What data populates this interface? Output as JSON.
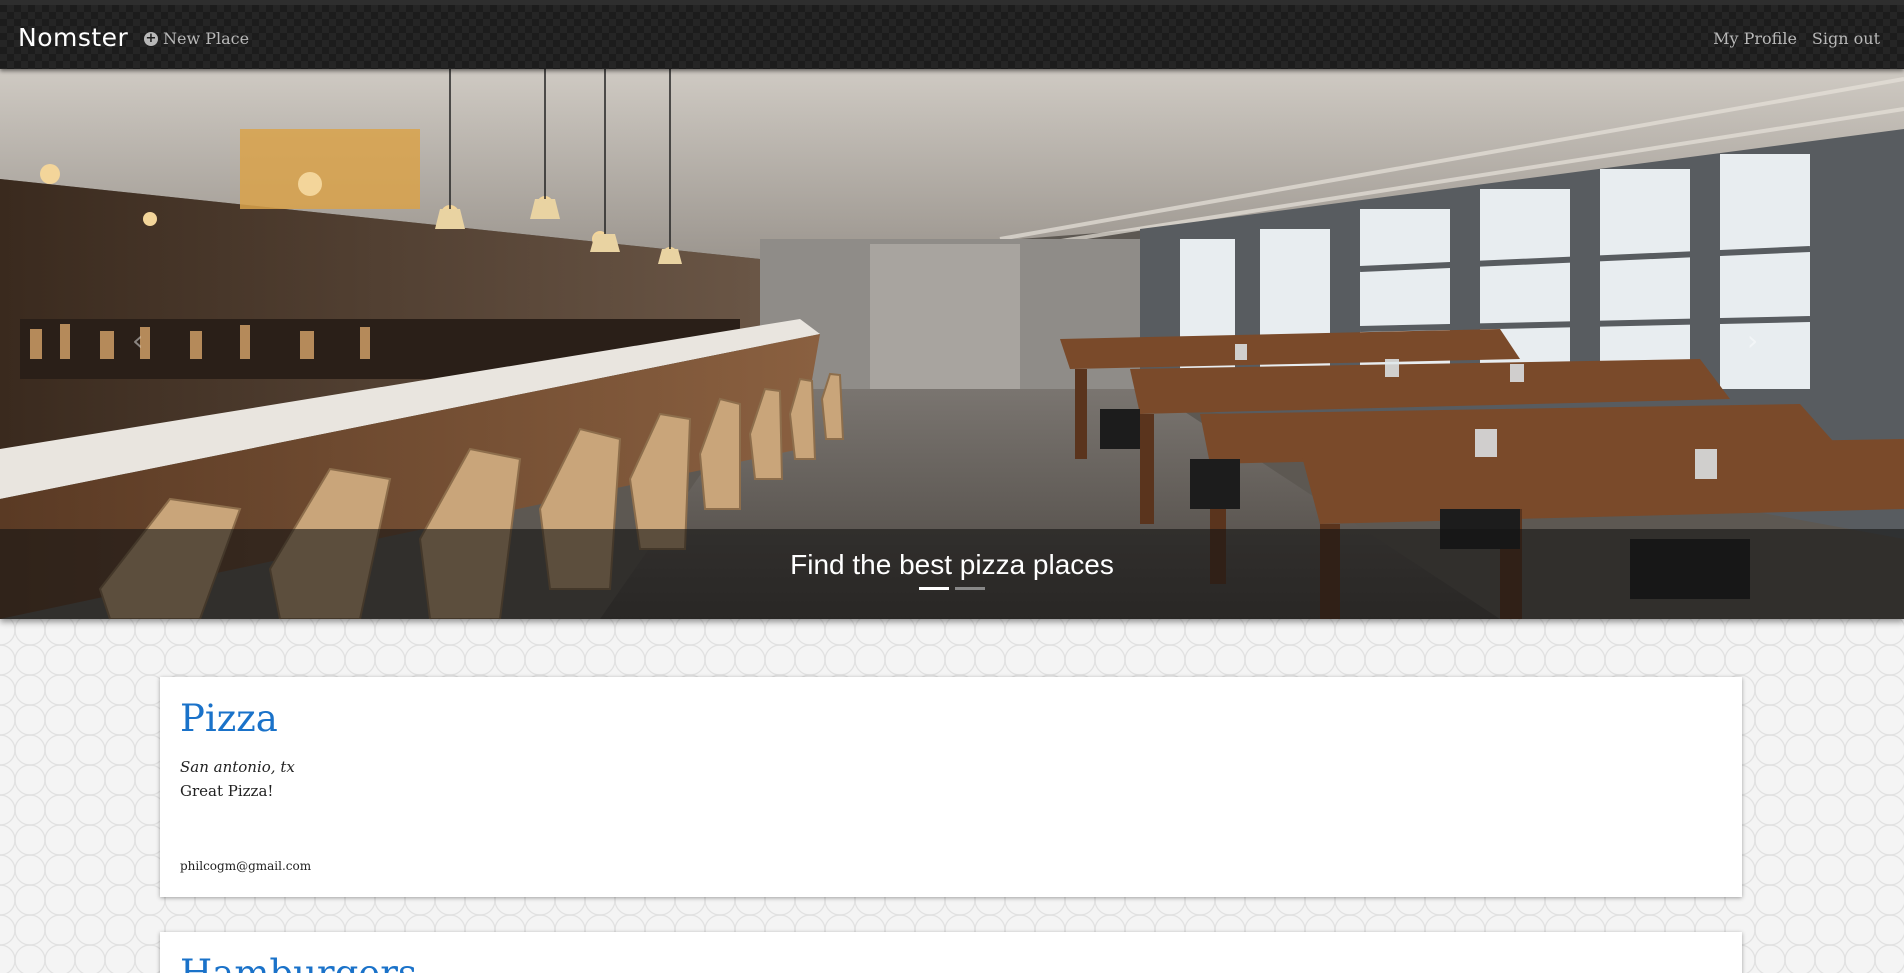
{
  "navbar": {
    "brand": "Nomster",
    "new_place_label": "New Place",
    "my_profile_label": "My Profile",
    "sign_out_label": "Sign out"
  },
  "carousel": {
    "caption": "Find the best pizza places",
    "slide_count": 2,
    "active_slide": 1
  },
  "places": [
    {
      "name": "Pizza",
      "location": "San antonio, tx",
      "description": "Great Pizza!",
      "email": "philcogm@gmail.com"
    },
    {
      "name": "Hamburgers"
    }
  ],
  "colors": {
    "navbar_bg": "#1c1c1c",
    "link_accent": "#1a72c9",
    "card_bg": "#ffffff"
  },
  "icons": {
    "new_place": "plus-circle-icon",
    "carousel_prev": "chevron-left-icon",
    "carousel_next": "chevron-right-icon"
  }
}
